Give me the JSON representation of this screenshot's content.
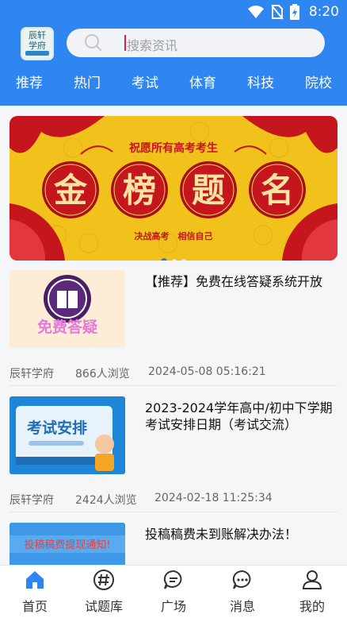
{
  "status": {
    "time": "8:20"
  },
  "search": {
    "placeholder": "搜索资讯"
  },
  "tabs": [
    "推荐",
    "热门",
    "考试",
    "体育",
    "科技",
    "院校"
  ],
  "banner": {
    "top_text": "祝愿所有高考考生",
    "main_chars": [
      "金",
      "榜",
      "题",
      "名"
    ],
    "bottom_text": "决战高考　相信自己",
    "slides": 3,
    "active_slide": 1
  },
  "articles": [
    {
      "title": "【推荐】免费在线答疑系统开放",
      "thumb_label": "免费答疑",
      "source": "辰轩学府",
      "views": "866人浏览",
      "date": "2024-05-08 05:16:21"
    },
    {
      "title": "2023-2024学年高中/初中下学期考试安排日期（考试交流）",
      "thumb_label": "考试安排",
      "source": "辰轩学府",
      "views": "2424人浏览",
      "date": "2024-02-18 11:25:34"
    },
    {
      "title": "投稿稿费未到账解决办法！",
      "thumb_label": "投稿稿费提现通知!"
    }
  ],
  "nav": [
    {
      "label": "首页",
      "icon": "home-icon",
      "active": true
    },
    {
      "label": "试题库",
      "icon": "hash-icon",
      "active": false
    },
    {
      "label": "广场",
      "icon": "chat-bubble-icon",
      "active": false
    },
    {
      "label": "消息",
      "icon": "message-dots-icon",
      "active": false
    },
    {
      "label": "我的",
      "icon": "user-icon",
      "active": false
    }
  ],
  "colors": {
    "primary": "#2f86f0",
    "banner_red": "#c4161c",
    "banner_gold": "#f2c21c"
  }
}
